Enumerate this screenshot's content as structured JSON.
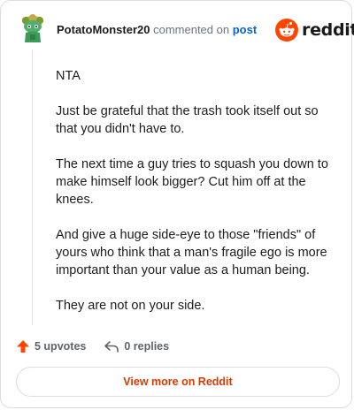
{
  "header": {
    "username": "PotatoMonster20",
    "action_text": "commented on",
    "post_link": "post",
    "brand": "reddit"
  },
  "comment": {
    "paragraphs": [
      "NTA",
      "Just be grateful that the trash took itself out so that you didn't have to.",
      "The next time a guy tries to squash you down to make himself look bigger? Cut him off at the knees.",
      "And give a huge side-eye to those \"friends\" of yours who think that a man's fragile ego is more important than your value as a human being.",
      "They are not on your side."
    ]
  },
  "actions": {
    "upvotes": "5 upvotes",
    "replies": "0 replies"
  },
  "footer": {
    "view_more": "View more on Reddit"
  },
  "colors": {
    "accent": "#d93a00",
    "upvote_icon": "#ff4500",
    "link": "#0a64c9",
    "reddit_orange": "#ff4500"
  },
  "icons": {
    "avatar": "snoo-avatar-icon",
    "logo": "reddit-logo-icon",
    "upvote": "upvote-arrow-icon",
    "reply": "reply-arrow-icon"
  }
}
